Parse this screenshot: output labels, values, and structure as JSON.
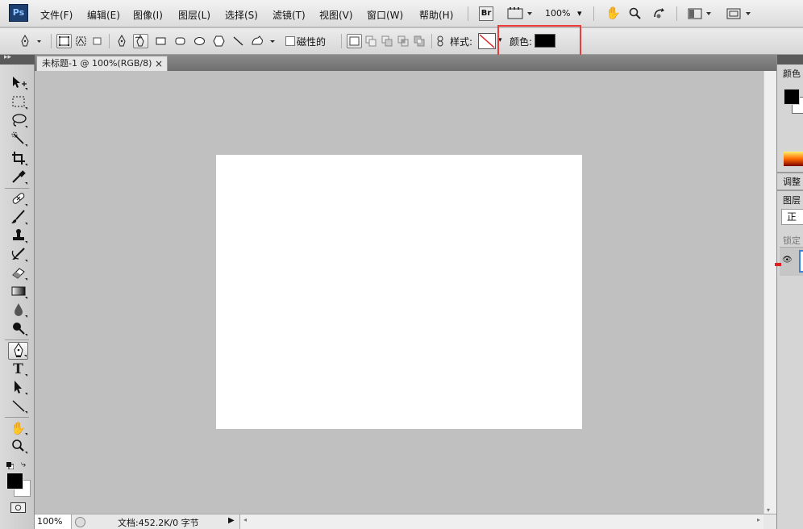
{
  "app": {
    "logo": "Ps"
  },
  "menus": [
    "文件(F)",
    "编辑(E)",
    "图像(I)",
    "图层(L)",
    "选择(S)",
    "滤镜(T)",
    "视图(V)",
    "窗口(W)",
    "帮助(H)"
  ],
  "app_bar": {
    "bridge": "Br",
    "zoom": "100%"
  },
  "options_bar": {
    "magnetic_label": "磁性的",
    "style_label": "样式:",
    "color_label": "颜色:",
    "color_value": "#000000"
  },
  "document": {
    "tab_title": "未标题-1 @ 100%(RGB/8)",
    "canvas_color": "#ffffff"
  },
  "statusbar": {
    "zoom": "100%",
    "doc_info": "文档:452.2K/0 字节"
  },
  "right_panels": {
    "color": "颜色",
    "adjust": "调整",
    "layers": "图层",
    "blend_mode": "正常",
    "lock": "锁定"
  },
  "toolbox": {
    "tools": [
      "move-tool",
      "marquee-tool",
      "lasso-tool",
      "quick-select-tool",
      "crop-tool",
      "eyedropper-tool",
      "healing-brush-tool",
      "brush-tool",
      "clone-stamp-tool",
      "history-brush-tool",
      "eraser-tool",
      "gradient-tool",
      "blur-tool",
      "dodge-tool",
      "pen-tool",
      "type-tool",
      "path-select-tool",
      "line-tool",
      "hand-tool",
      "zoom-tool"
    ],
    "active_tool": "pen-tool",
    "foreground": "#000000",
    "background": "#ffffff"
  },
  "annotation": {
    "highlight_color": "#ee3b3b"
  }
}
